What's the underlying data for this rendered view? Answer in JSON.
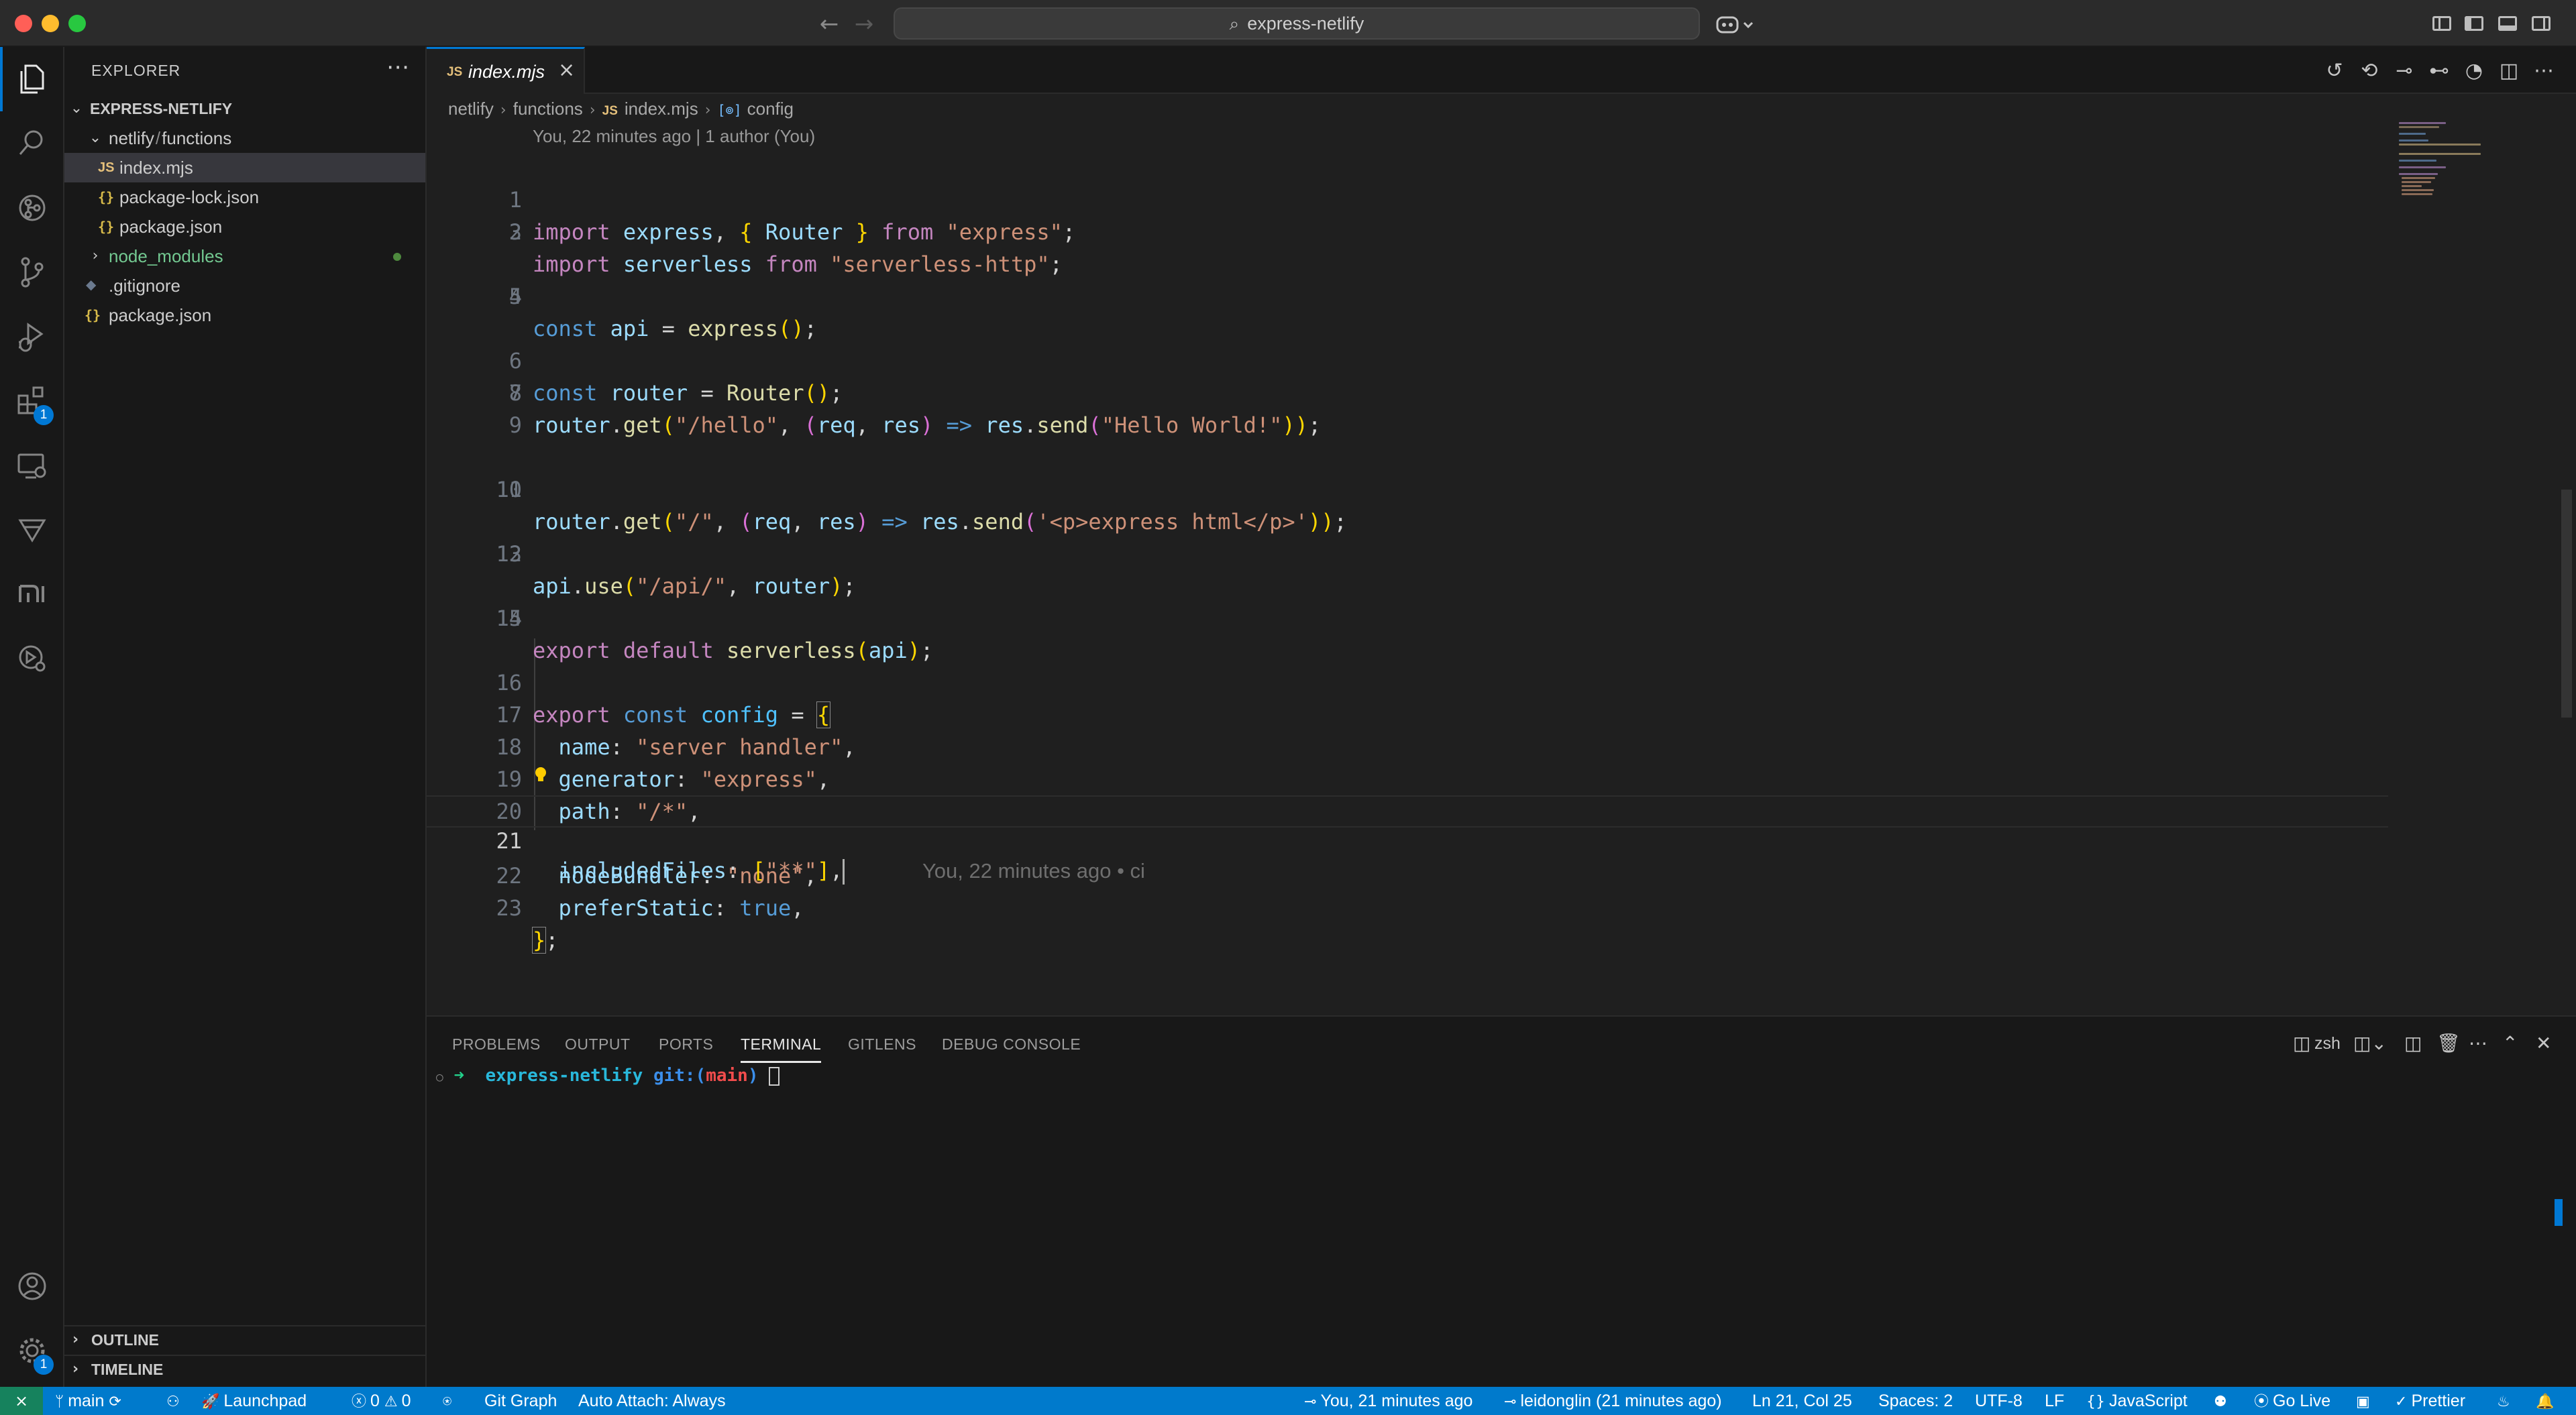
{
  "window": {
    "search_text": "express-netlify"
  },
  "explorer": {
    "title": "EXPLORER",
    "root": "EXPRESS-NETLIFY",
    "tree": {
      "folder_netlify": "netlify",
      "folder_sep": "/",
      "folder_functions": "functions",
      "file_index": "index.mjs",
      "file_lock": "package-lock.json",
      "file_pkg_inner": "package.json",
      "folder_node_modules": "node_modules",
      "file_gitignore": ".gitignore",
      "file_pkg_root": "package.json"
    },
    "icons": {
      "js": "JS",
      "json": "{}"
    },
    "outline": "OUTLINE",
    "timeline": "TIMELINE"
  },
  "activity": {
    "extensions_badge": "1",
    "settings_badge": "1"
  },
  "editor": {
    "tab_label": "index.mjs",
    "tab_icon": "JS",
    "breadcrumbs": {
      "b1": "netlify",
      "b2": "functions",
      "b3": "index.mjs",
      "b4": "config",
      "sym": "[⊚]"
    },
    "codelens": "You, 22 minutes ago | 1 author (You)",
    "line_numbers": [
      "1",
      "2",
      "3",
      "4",
      "5",
      "6",
      "7",
      "8",
      "9",
      "10",
      "11",
      "12",
      "13",
      "14",
      "15",
      "16",
      "17",
      "18",
      "19",
      "20",
      "21",
      "22",
      "23"
    ],
    "tokens": {
      "l1": [
        "import",
        "express",
        ", ",
        "{",
        " Router ",
        "}",
        " from ",
        "\"express\"",
        ";"
      ],
      "l2": [
        "import",
        " serverless ",
        "from ",
        "\"serverless-http\"",
        ";"
      ],
      "l4": [
        "const",
        " api ",
        "= ",
        "express",
        "()",
        ";"
      ],
      "l6": [
        "const",
        " router ",
        "= ",
        "Router",
        "()",
        ";"
      ],
      "l7": [
        "router",
        ".",
        "get",
        "(",
        "\"/hello\"",
        ", ",
        "(",
        "req",
        ", ",
        "res",
        ")",
        " => ",
        "res",
        ".",
        "send",
        "(",
        "\"Hello World!\"",
        "))",
        ";"
      ],
      "l10": [
        "router",
        ".",
        "get",
        "(",
        "\"/\"",
        ", ",
        "(",
        "req",
        ", ",
        "res",
        ")",
        " => ",
        "res",
        ".",
        "send",
        "(",
        "'<p>express html</p>'",
        "))",
        ";"
      ],
      "l12": [
        "api",
        ".",
        "use",
        "(",
        "\"/api/\"",
        ", ",
        "router",
        ")",
        ";"
      ],
      "l14": [
        "export",
        " default ",
        "serverless",
        "(",
        "api",
        ")",
        ";"
      ],
      "l16": [
        "export",
        " const ",
        "config",
        " = ",
        "{"
      ],
      "l17": [
        "name",
        ": ",
        "\"server handler\"",
        ","
      ],
      "l18": [
        "generator",
        ": ",
        "\"express\"",
        ","
      ],
      "l19": [
        "path",
        ": ",
        "\"/*\"",
        ","
      ],
      "l20": [
        "nodeBundler",
        ": ",
        "\"none\"",
        ","
      ],
      "l21": [
        "includedFiles",
        ": ",
        "[",
        "\"**\"",
        "]",
        ","
      ],
      "l22": [
        "preferStatic",
        ": ",
        "true",
        ","
      ],
      "l23": [
        "}",
        ";"
      ]
    },
    "blame_inline": "You, 22 minutes ago • ci"
  },
  "panel": {
    "tabs": [
      "PROBLEMS",
      "OUTPUT",
      "PORTS",
      "TERMINAL",
      "GITLENS",
      "DEBUG CONSOLE"
    ],
    "active_tab": "TERMINAL",
    "shell": "zsh",
    "terminal": {
      "arrow": "➜",
      "dir": "express-netlify",
      "git_prefix": "git:(",
      "branch": "main",
      "git_suffix": ")"
    }
  },
  "status": {
    "branch": "main",
    "launchpad": "Launchpad",
    "errors": "0",
    "warnings": "0",
    "git_graph": "Git Graph",
    "auto_attach": "Auto Attach: Always",
    "blame": "You, 21 minutes ago",
    "author": "leidonglin (21 minutes ago)",
    "position": "Ln 21, Col 25",
    "spaces": "Spaces: 2",
    "encoding": "UTF-8",
    "eol": "LF",
    "language": "JavaScript",
    "go_live": "Go Live",
    "prettier": "Prettier"
  },
  "colors": {
    "accent": "#0078d4",
    "statusbar": "#007acc",
    "editor_bg": "#1f1f1f",
    "sidebar_bg": "#181818"
  }
}
